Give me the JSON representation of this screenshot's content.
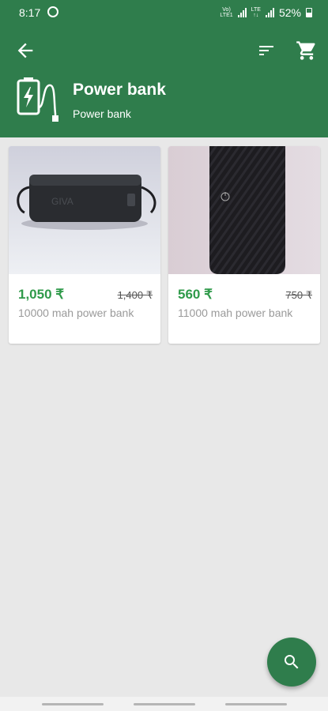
{
  "status_bar": {
    "time": "8:17",
    "battery": "52%",
    "network": "Vo) LTE LTE1"
  },
  "header": {
    "title": "Power bank",
    "subtitle": "Power bank"
  },
  "products": [
    {
      "price": "1,050 ₹",
      "old_price": "1,400 ₹",
      "name": "10000 mah power bank"
    },
    {
      "price": "560 ₹",
      "old_price": "750 ₹",
      "name": "11000 mah power bank"
    }
  ],
  "colors": {
    "primary": "#2f7d4c",
    "price_green": "#2f9a4a",
    "background": "#e8e8e8"
  },
  "icons": {
    "back": "arrow-back-icon",
    "sort": "sort-icon",
    "cart": "shopping-cart-icon",
    "category": "power-bank-icon",
    "search": "search-icon"
  }
}
